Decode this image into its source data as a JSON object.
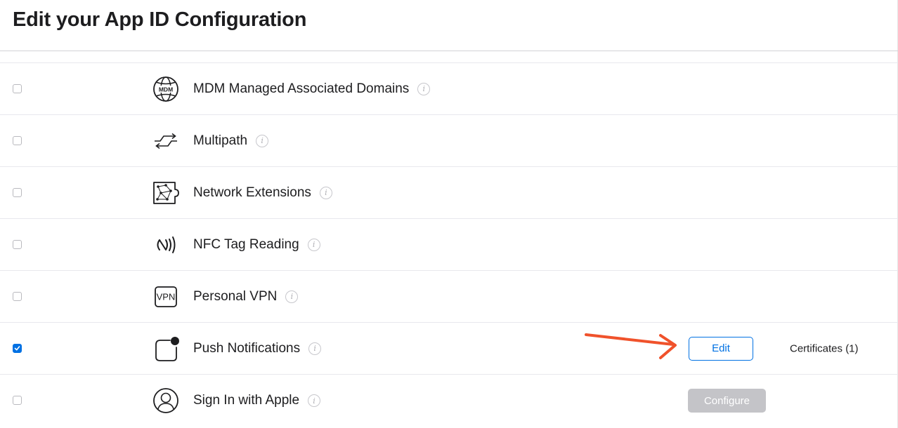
{
  "page": {
    "title": "Edit your App ID Configuration"
  },
  "capabilities": [
    {
      "label": "MDM Managed Associated Domains",
      "icon": "mdm-globe-icon",
      "checked": false
    },
    {
      "label": "Multipath",
      "icon": "multipath-arrows-icon",
      "checked": false
    },
    {
      "label": "Network Extensions",
      "icon": "network-extensions-icon",
      "checked": false
    },
    {
      "label": "NFC Tag Reading",
      "icon": "nfc-icon",
      "checked": false
    },
    {
      "label": "Personal VPN",
      "icon": "vpn-icon",
      "icon_text": "VPN",
      "checked": false
    },
    {
      "label": "Push Notifications",
      "icon": "push-notification-icon",
      "checked": true,
      "edit_label": "Edit",
      "certificates_label": "Certificates (1)"
    },
    {
      "label": "Sign In with Apple",
      "icon": "person-circle-icon",
      "checked": false,
      "configure_label": "Configure",
      "configure_enabled": false
    }
  ],
  "icons": {
    "info": "i"
  },
  "colors": {
    "accent": "#0071e3",
    "annotation_arrow": "#f0522b",
    "disabled_button": "#c4c4c8"
  }
}
